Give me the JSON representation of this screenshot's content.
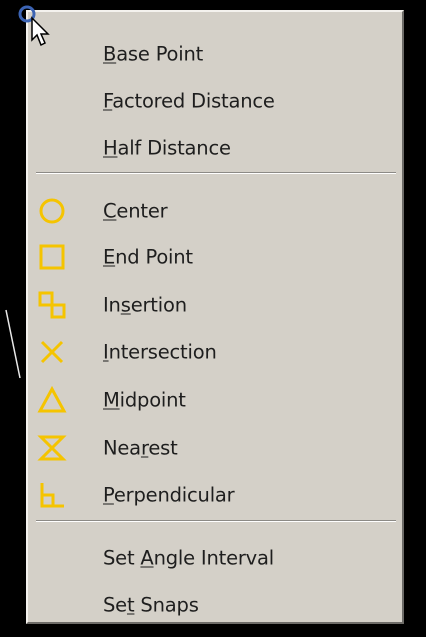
{
  "menu": {
    "items": [
      {
        "key": "base_point",
        "pre": "",
        "acc": "B",
        "post": "ase Point",
        "icon": ""
      },
      {
        "key": "factored_distance",
        "pre": "",
        "acc": "F",
        "post": "actored Distance",
        "icon": ""
      },
      {
        "key": "half_distance",
        "pre": "",
        "acc": "H",
        "post": "alf Distance",
        "icon": ""
      },
      {
        "key": "center",
        "pre": "",
        "acc": "C",
        "post": "enter",
        "icon": "circle-icon"
      },
      {
        "key": "end_point",
        "pre": "",
        "acc": "E",
        "post": "nd Point",
        "icon": "square-icon"
      },
      {
        "key": "insertion",
        "pre": "In",
        "acc": "s",
        "post": "ertion",
        "icon": "insertion-icon"
      },
      {
        "key": "intersection",
        "pre": "",
        "acc": "I",
        "post": "ntersection",
        "icon": "cross-icon"
      },
      {
        "key": "midpoint",
        "pre": "",
        "acc": "M",
        "post": "idpoint",
        "icon": "triangle-icon"
      },
      {
        "key": "nearest",
        "pre": "Nea",
        "acc": "r",
        "post": "est",
        "icon": "hourglass-icon"
      },
      {
        "key": "perpendicular",
        "pre": "",
        "acc": "P",
        "post": "erpendicular",
        "icon": "perpendicular-icon"
      },
      {
        "key": "set_angle_interval",
        "pre": "Set ",
        "acc": "A",
        "post": "ngle Interval",
        "icon": ""
      },
      {
        "key": "set_snaps",
        "pre": "Se",
        "acc": "t",
        "post": " Snaps",
        "icon": ""
      }
    ]
  },
  "colors": {
    "menu_background": "#d4d0c8",
    "text": "#1e1e1e",
    "snap_icon": "#f5c400",
    "cursor_ring": "#3c64b4",
    "background": "#000000"
  }
}
